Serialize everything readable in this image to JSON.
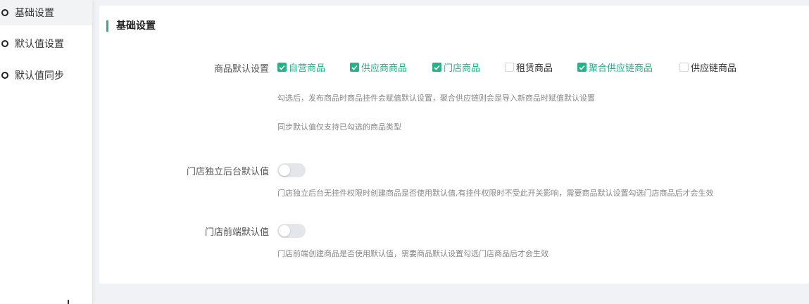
{
  "sidebar": {
    "items": [
      {
        "label": "基础设置",
        "active": true
      },
      {
        "label": "默认值设置",
        "active": false
      },
      {
        "label": "默认值同步",
        "active": false
      }
    ]
  },
  "section": {
    "title": "基础设置"
  },
  "product_default": {
    "label": "商品默认设置",
    "options": [
      {
        "label": "自营商品",
        "checked": true
      },
      {
        "label": "供应商商品",
        "checked": true
      },
      {
        "label": "门店商品",
        "checked": true
      },
      {
        "label": "租赁商品",
        "checked": false
      },
      {
        "label": "聚合供应链商品",
        "checked": true
      },
      {
        "label": "供应链商品",
        "checked": false
      }
    ],
    "hint1": "勾选后，发布商品时商品挂件会赋值默认设置，聚合供应链则会是导入新商品时赋值默认设置",
    "hint2": "同步默认值仅支持已勾选的商品类型"
  },
  "store_backend_default": {
    "label": "门店独立后台默认值",
    "enabled": false,
    "hint": "门店独立后台无挂件权限时创建商品是否使用默认值,有挂件权限时不受此开关影响，需要商品默认设置勾选门店商品后才会生效"
  },
  "store_frontend_default": {
    "label": "门店前端默认值",
    "enabled": false,
    "hint": "门店前端创建商品是否使用默认值，需要商品默认设置勾选门店商品后才会生效"
  },
  "colors": {
    "accent": "#2ab087",
    "toggle_off": "#e4e6eb"
  }
}
